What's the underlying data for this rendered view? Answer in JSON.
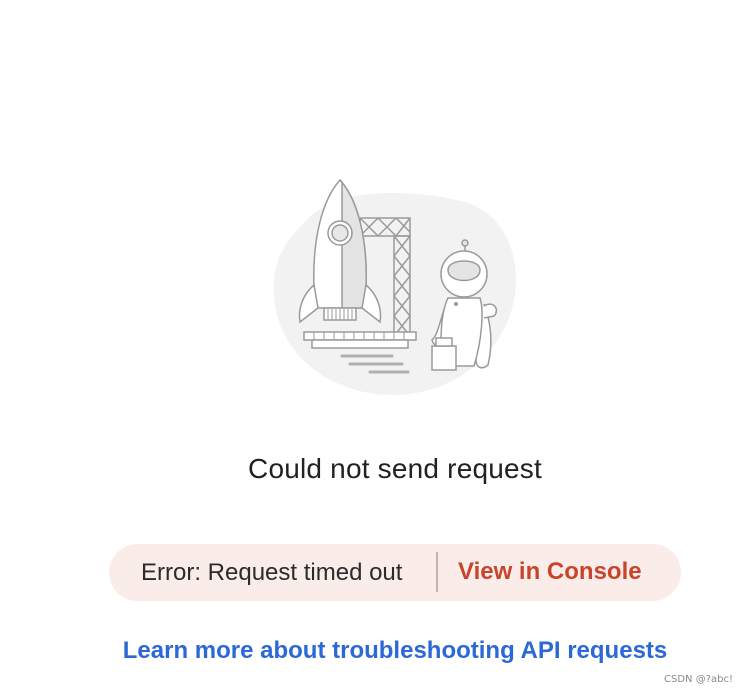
{
  "illustration": {
    "icon": "rocket-astronaut-illustration"
  },
  "message": {
    "title": "Could not send request"
  },
  "error": {
    "text": "Error: Request timed out",
    "console_link": "View in Console"
  },
  "help": {
    "link_text": "Learn more about troubleshooting API requests"
  },
  "watermark": {
    "text": "CSDN @?abc!"
  },
  "colors": {
    "error_background": "#faece8",
    "console_link": "#c8442d",
    "help_link": "#2c69d6"
  }
}
